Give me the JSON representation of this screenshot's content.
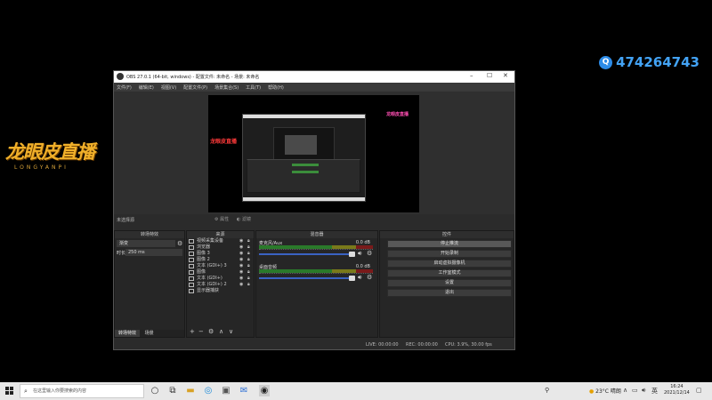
{
  "logo": {
    "title": "龙眼皮直播",
    "subtitle": "LONGYANPI"
  },
  "qq": {
    "icon": "qq-icon",
    "number": "474264743"
  },
  "obs": {
    "title": "OBS 27.0.1 (64-bit, windows) - 配置文件: 未命名 - 场景: 未命名",
    "menu": [
      "文件(F)",
      "编辑(E)",
      "视图(V)",
      "配置文件(P)",
      "场景集合(S)",
      "工具(T)",
      "帮助(H)"
    ],
    "preview_overlay_pink": "龙眼皮直播",
    "preview_overlay_red": "龙眼皮直播",
    "source_bar": {
      "label": "未选择源",
      "properties": "属性",
      "filters": "滤镜"
    },
    "transitions": {
      "header": "转场特效",
      "selected": "渐变",
      "duration_label": "时长",
      "duration_value": "250 ms",
      "tab_active": "转场特效",
      "tab_other": "场景"
    },
    "sources": {
      "header": "来源",
      "items": [
        {
          "label": "视频采集设备"
        },
        {
          "label": "浏览器"
        },
        {
          "label": "图像 3"
        },
        {
          "label": "图像 2"
        },
        {
          "label": "文本 (GDI+) 3"
        },
        {
          "label": "图像"
        },
        {
          "label": "文本 (GDI+)"
        },
        {
          "label": "文本 (GDI+) 2"
        },
        {
          "label": "显示器捕获"
        }
      ]
    },
    "mixer": {
      "header": "混音器",
      "channels": [
        {
          "name": "麦克风/Aux",
          "db": "0.0 dB"
        },
        {
          "name": "桌面音频",
          "db": "0.0 dB"
        }
      ]
    },
    "controls": {
      "header": "控件",
      "buttons": [
        "停止推流",
        "开始录制",
        "启动虚拟摄像机",
        "工作室模式",
        "设置",
        "退出"
      ]
    },
    "status": {
      "live": "LIVE: 00:00:00",
      "rec": "REC: 00:00:00",
      "cpu": "CPU: 3.9%, 30.00 fps"
    }
  },
  "taskbar": {
    "search_placeholder": "在这里输入你要搜索的内容",
    "weather": "23°C 晴朗",
    "time": "16:24",
    "date": "2021/12/14"
  }
}
